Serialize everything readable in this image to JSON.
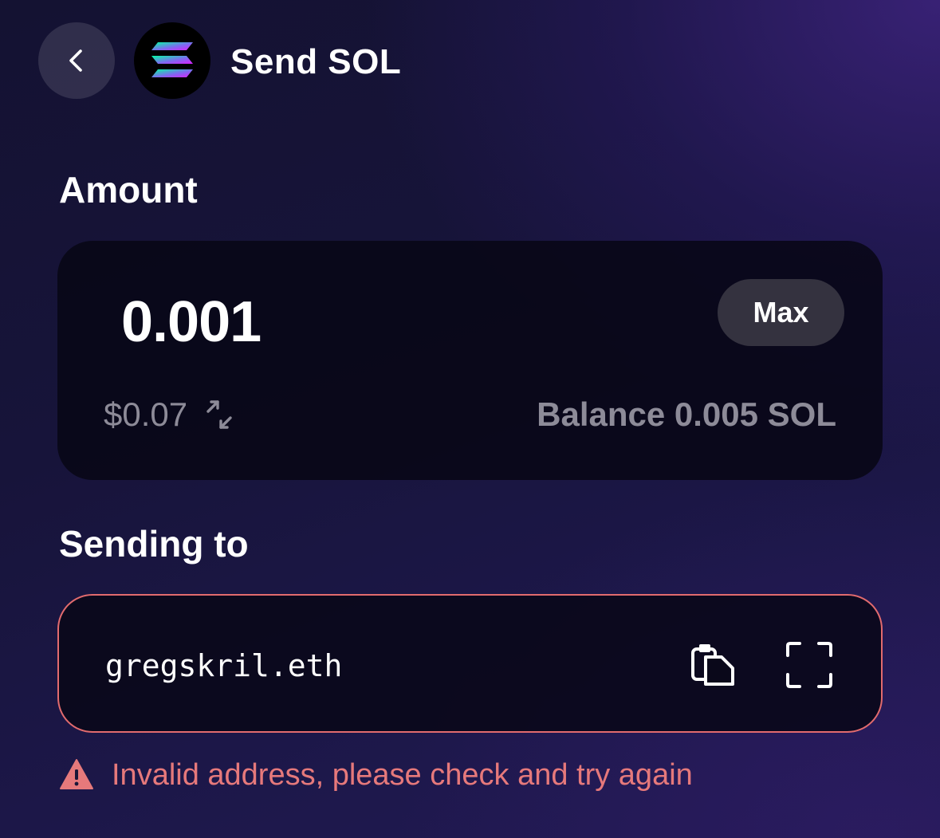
{
  "header": {
    "back_icon": "chevron-left-icon",
    "token_icon": "solana-logo-icon",
    "title": "Send SOL"
  },
  "amount_section": {
    "label": "Amount",
    "value": "0.001",
    "max_label": "Max",
    "usd_value": "$0.07",
    "swap_icon": "swap-arrows-icon",
    "balance": "Balance 0.005 SOL"
  },
  "recipient_section": {
    "label": "Sending to",
    "address": "gregskril.eth",
    "paste_icon": "clipboard-icon",
    "scan_icon": "scan-qr-icon"
  },
  "error": {
    "icon": "warning-icon",
    "message": "Invalid address, please check and try again"
  },
  "colors": {
    "error": "#e6797b",
    "error_border": "#e26b6e",
    "muted_text": "#8d8b98",
    "max_button_bg": "#34323f"
  }
}
